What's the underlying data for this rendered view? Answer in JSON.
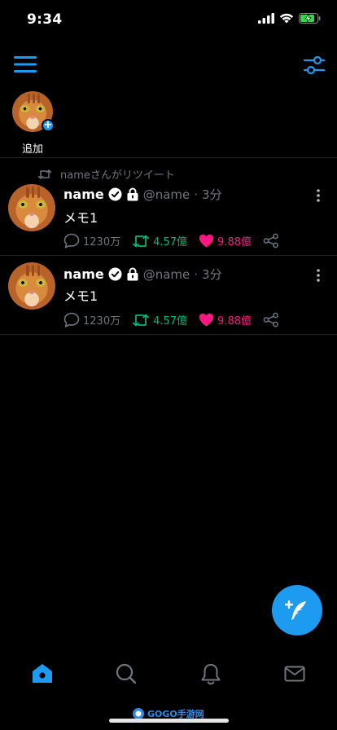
{
  "status_bar": {
    "time": "9:34"
  },
  "stories": {
    "add_label": "追加"
  },
  "retweet_context": "nameさんがリツイート",
  "tweets": [
    {
      "name": "name",
      "handle": "@name",
      "separator": "·",
      "time": "3分",
      "text": "メモ1",
      "replies": "1230万",
      "retweets": "4.57億",
      "likes": "9.88億"
    },
    {
      "name": "name",
      "handle": "@name",
      "separator": "·",
      "time": "3分",
      "text": "メモ1",
      "replies": "1230万",
      "retweets": "4.57億",
      "likes": "9.88億"
    }
  ],
  "watermark": "GOGO手游网",
  "colors": {
    "accent": "#1d9bf0",
    "retweet": "#00ba7c",
    "like": "#f91880",
    "muted": "#71767b",
    "background": "#000000"
  },
  "icons": {
    "menu": "hamburger-icon",
    "filter": "sliders-icon",
    "verified": "verified-badge-icon",
    "protected": "lock-icon",
    "reply": "speech-bubble-icon",
    "retweet": "retweet-icon",
    "like": "heart-icon",
    "share": "share-icon",
    "compose": "feather-plus-icon",
    "tabs": [
      "home-icon",
      "search-icon",
      "bell-icon",
      "mail-icon"
    ]
  }
}
